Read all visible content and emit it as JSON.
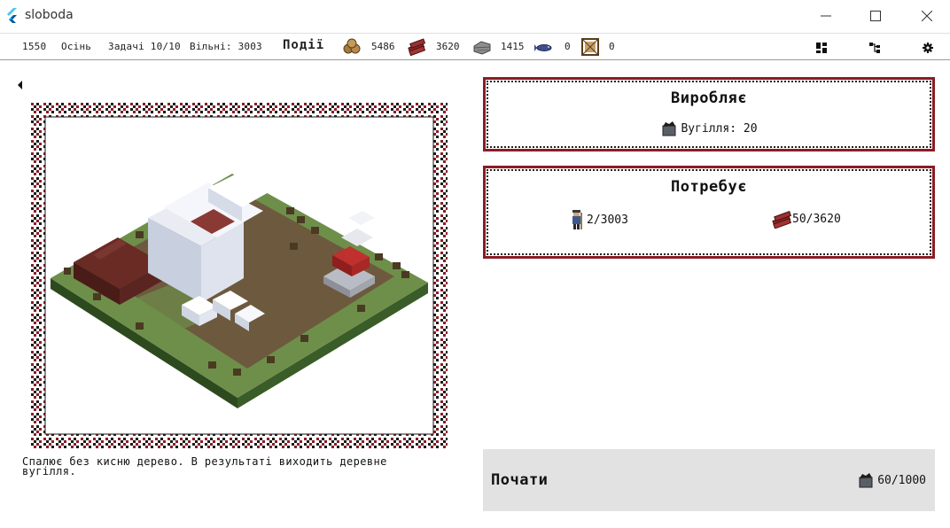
{
  "window": {
    "title": "sloboda"
  },
  "status": {
    "year": "1550",
    "season": "Осінь",
    "tasks": "Задачі 10/10",
    "free": "Вільні: 3003",
    "events_label": "Події",
    "resources": [
      {
        "icon": "logs-icon",
        "value": "5486"
      },
      {
        "icon": "wood-bundle-icon",
        "value": "3620"
      },
      {
        "icon": "stone-icon",
        "value": "1415"
      },
      {
        "icon": "fish-icon",
        "value": "0"
      },
      {
        "icon": "fur-frame-icon",
        "value": "0"
      }
    ]
  },
  "produces": {
    "title": "Виробляє",
    "item": "Вугілля: 20"
  },
  "requires": {
    "title": "Потребує",
    "workers": "2/3003",
    "wood": "50/3620"
  },
  "description": "Спалює без кисню дерево. В результаті виходить деревне вугілля.",
  "action": {
    "start_label": "Почати",
    "cost": "60/1000"
  },
  "colors": {
    "ornament_red": "#8a1c24",
    "ornament_black": "#1a1a1a",
    "grass": "#6e8f4a",
    "dirt": "#6d5a3e",
    "action_bg": "#e2e2e2"
  }
}
